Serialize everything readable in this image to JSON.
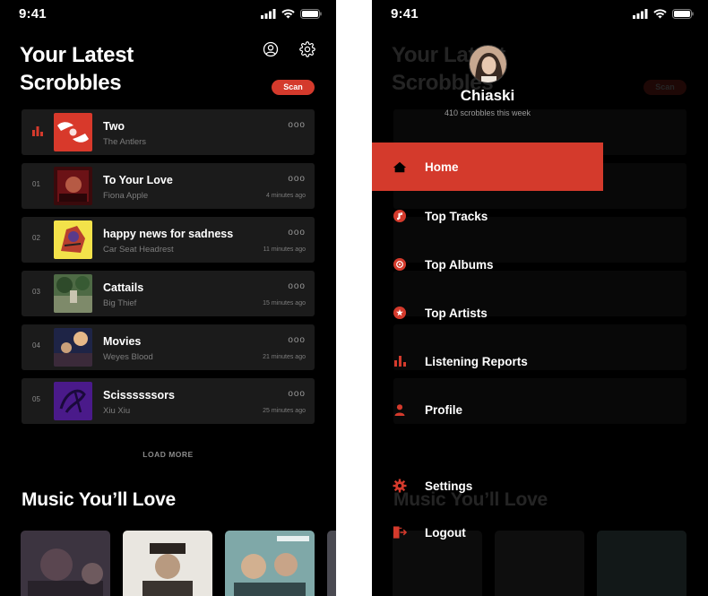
{
  "status": {
    "time": "9:41"
  },
  "left": {
    "title": "Your Latest Scrobbles",
    "scan_label": "Scan",
    "scrobbles": [
      {
        "index": "",
        "title": "Two",
        "artist": "The Antlers",
        "time": "",
        "more": "ooo",
        "now_playing": true
      },
      {
        "index": "01",
        "title": "To Your Love",
        "artist": "Fiona Apple",
        "time": "4 minutes ago",
        "more": "ooo"
      },
      {
        "index": "02",
        "title": "happy news for sadness",
        "artist": "Car Seat Headrest",
        "time": "11 minutes ago",
        "more": "ooo"
      },
      {
        "index": "03",
        "title": "Cattails",
        "artist": "Big Thief",
        "time": "15 minutes ago",
        "more": "ooo"
      },
      {
        "index": "04",
        "title": "Movies",
        "artist": "Weyes Blood",
        "time": "21 minutes ago",
        "more": "ooo"
      },
      {
        "index": "05",
        "title": "Scissssssors",
        "artist": "Xiu Xiu",
        "time": "25 minutes ago",
        "more": "ooo"
      }
    ],
    "load_more_label": "LOAD MORE",
    "section_title": "Music You’ll Love",
    "accent": "#d43a2c"
  },
  "right": {
    "profile": {
      "name": "Chiaski",
      "subtitle": "410 scrobbles this week"
    },
    "menu": [
      {
        "label": "Home",
        "icon": "home-icon",
        "active": true
      },
      {
        "label": "Top Tracks",
        "icon": "music-note-icon"
      },
      {
        "label": "Top Albums",
        "icon": "album-icon"
      },
      {
        "label": "Top Artists",
        "icon": "star-icon"
      },
      {
        "label": "Listening Reports",
        "icon": "bar-chart-icon"
      },
      {
        "label": "Profile",
        "icon": "person-icon"
      },
      {
        "label": "Settings",
        "icon": "gear-icon"
      },
      {
        "label": "Logout",
        "icon": "logout-icon"
      }
    ]
  }
}
